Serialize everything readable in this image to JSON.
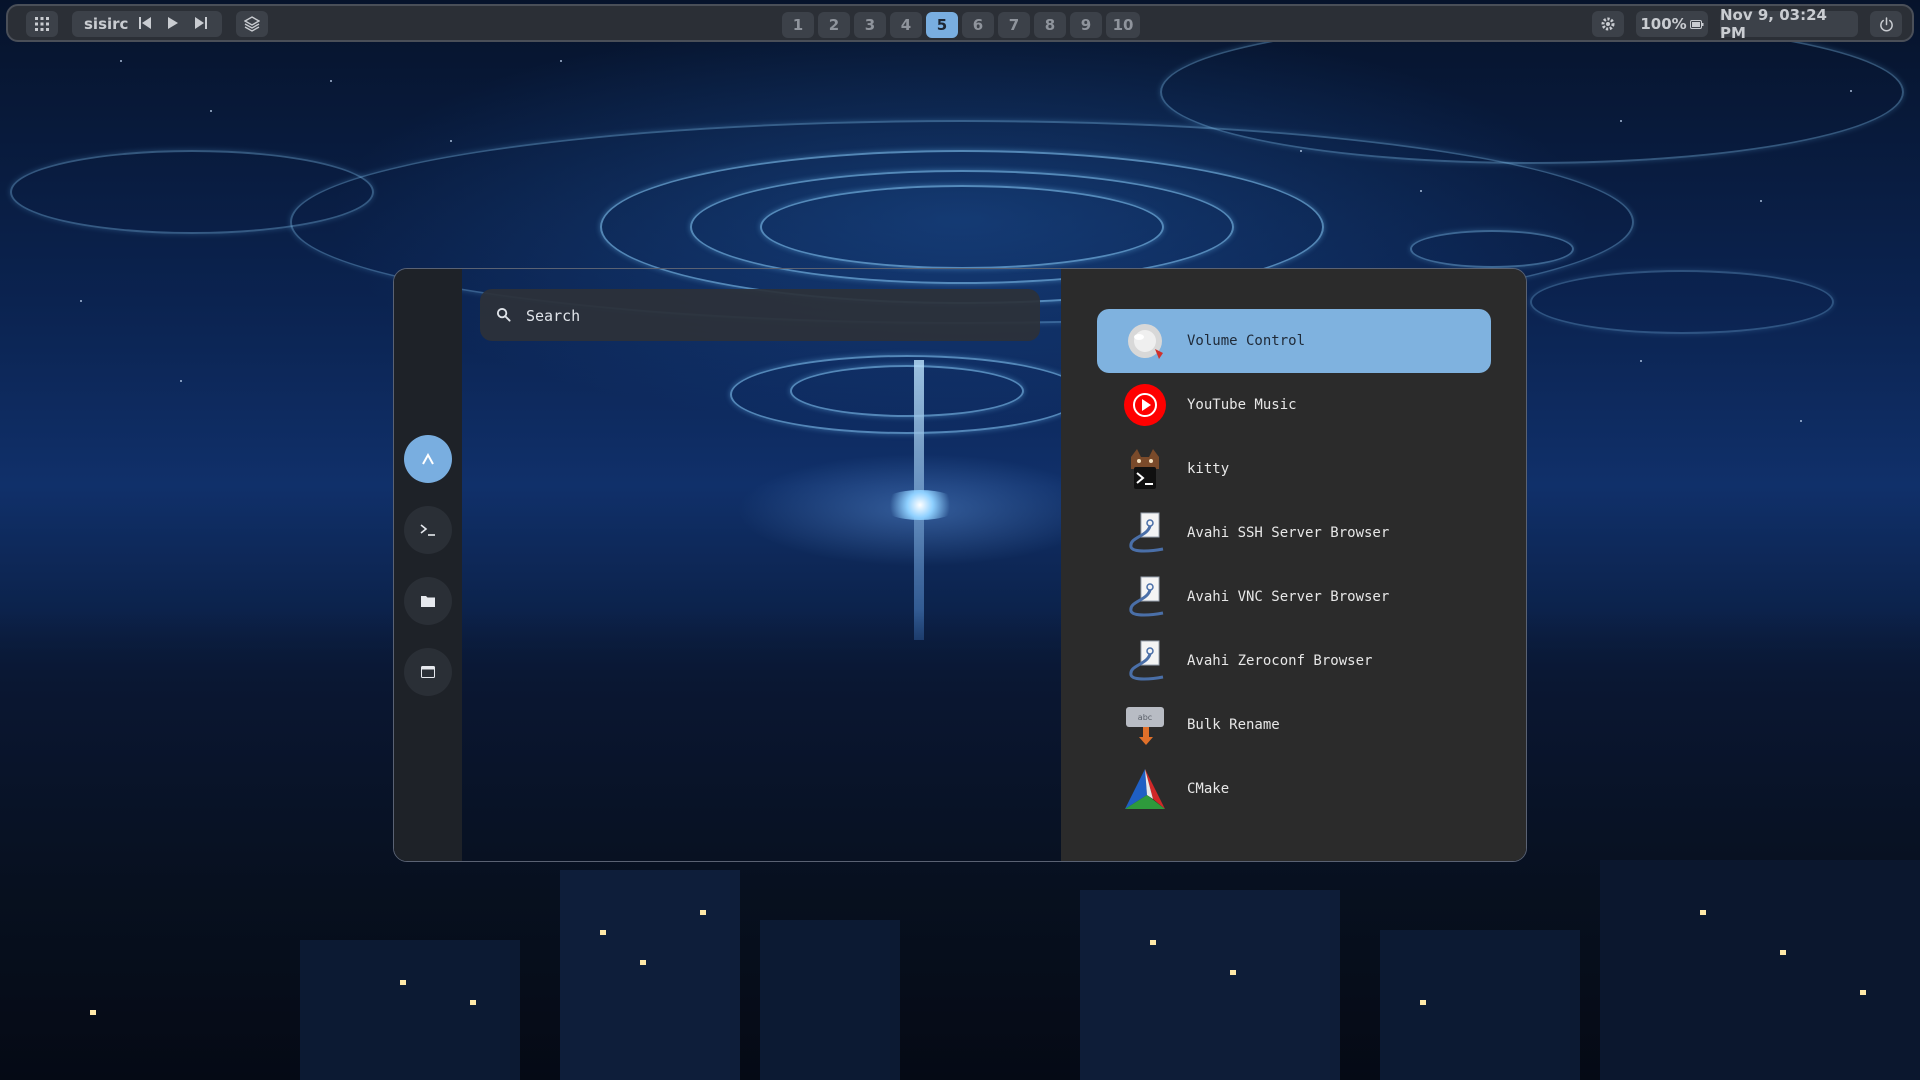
{
  "topbar": {
    "apps_icon": "grid-icon",
    "media_title": "sisirc",
    "media_controls": [
      "skip-previous-icon",
      "play-icon",
      "skip-next-icon"
    ],
    "layers_icon": "layers-icon",
    "workspaces": [
      "1",
      "2",
      "3",
      "4",
      "5",
      "6",
      "7",
      "8",
      "9",
      "10"
    ],
    "active_workspace": "5",
    "settings_icon": "gear-icon",
    "battery_label": "100%",
    "datetime": "Nov 9, 03:24 PM",
    "power_icon": "power-icon"
  },
  "launcher": {
    "search": {
      "placeholder": "Search",
      "value": ""
    },
    "sidebar": [
      "apps-icon",
      "terminal-icon",
      "folder-icon",
      "window-icon"
    ],
    "apps": [
      {
        "label": "Volume Control",
        "icon": "speaker-icon",
        "selected": true
      },
      {
        "label": "YouTube Music",
        "icon": "youtube-music-icon"
      },
      {
        "label": "kitty",
        "icon": "kitty-terminal-icon"
      },
      {
        "label": "Avahi SSH Server Browser",
        "icon": "avahi-icon"
      },
      {
        "label": "Avahi VNC Server Browser",
        "icon": "avahi-icon"
      },
      {
        "label": "Avahi Zeroconf Browser",
        "icon": "avahi-icon"
      },
      {
        "label": "Bulk Rename",
        "icon": "bulk-rename-icon"
      },
      {
        "label": "CMake",
        "icon": "cmake-icon"
      }
    ]
  },
  "colors": {
    "accent": "#79aee0",
    "selection": "#7fb2df",
    "panel": "#2b2b2b",
    "sidebar": "#1e2228"
  }
}
